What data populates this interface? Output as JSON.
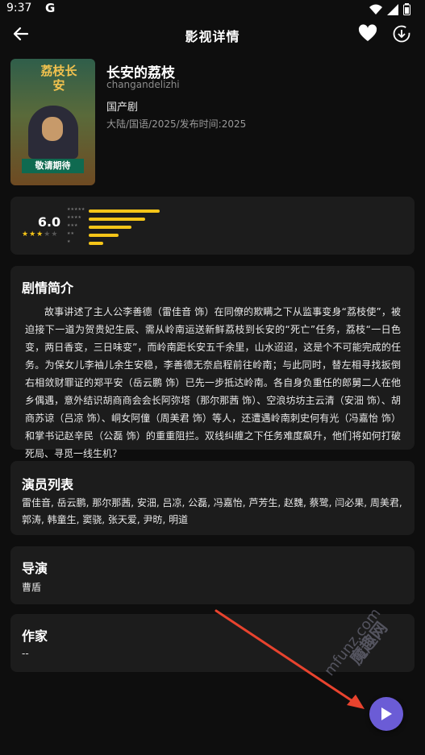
{
  "status_bar": {
    "time": "9:37",
    "app_letter": "G",
    "icons": [
      "wifi-icon",
      "signal-icon",
      "battery-icon"
    ]
  },
  "app_bar": {
    "title": "影视详情",
    "back_icon": "arrow-left-icon",
    "favorite_icon": "heart-icon",
    "download_icon": "download-circle-icon"
  },
  "movie": {
    "poster_title": "荔枝长安",
    "poster_banner": "敬请期待",
    "title": "长安的荔枝",
    "pinyin": "changandelizhi",
    "category": "国产剧",
    "meta": "大陆/国语/2025/发布时间:2025"
  },
  "rating": {
    "score": "6.0",
    "stars_filled": 3,
    "stars_total": 5,
    "distribution": [
      {
        "stars": 5,
        "fraction": 1.0
      },
      {
        "stars": 4,
        "fraction": 0.8
      },
      {
        "stars": 3,
        "fraction": 0.6
      },
      {
        "stars": 2,
        "fraction": 0.42
      },
      {
        "stars": 1,
        "fraction": 0.2
      }
    ],
    "accent_color": "#f5c518"
  },
  "synopsis": {
    "heading": "剧情简介",
    "text": "故事讲述了主人公李善德（雷佳音 饰）在同僚的欺瞒之下从监事变身“荔枝使”，被迫接下一道为贺贵妃生辰、需从岭南运送新鲜荔枝到长安的“死亡”任务，荔枝“一日色变，两日香变，三日味变”，而岭南距长安五千余里，山水迢迢，这是个不可能完成的任务。为保女儿李袖儿余生安稳，李善德无奈启程前往岭南；与此同时，替左相寻找扳倒右相敛财罪证的郑平安（岳云鹏 饰）已先一步抵达岭南。各自身负重任的郎舅二人在他乡偶遇，意外结识胡商商会会长阿弥塔（那尔那茜 饰）、空浪坊坊主云清（安沺 饰）、胡商苏谅（吕凉 饰）、峒女阿僮（周美君 饰）等人，还遭遇岭南刺史何有光（冯嘉怡 饰）和掌书记赵辛民（公磊 饰）的重重阻拦。双线纠缠之下任务难度飙升，他们将如何打破死局、寻觅一线生机？"
  },
  "cast": {
    "heading": "演员列表",
    "text": "雷佳音, 岳云鹏, 那尔那茜, 安沺, 吕凉, 公磊, 冯嘉怡, 芦芳生, 赵魏, 蔡鹭, 闫必果, 周美君, 郭涛, 韩童生, 窦骁, 张天爱, 尹昉, 明道"
  },
  "director": {
    "heading": "导演",
    "text": "曹盾"
  },
  "writer": {
    "heading": "作家",
    "text": "--"
  },
  "watermark": {
    "line1": "mfunz.com",
    "line2": "魔趣网"
  },
  "play_button": {
    "icon": "play-icon",
    "color": "#6b5cd6"
  }
}
